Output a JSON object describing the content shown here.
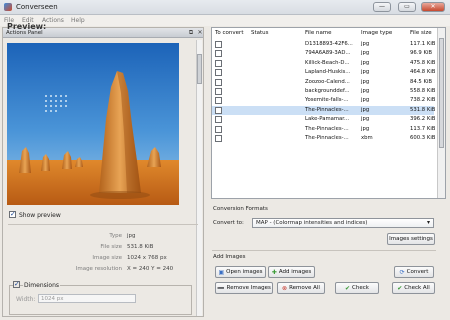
{
  "window": {
    "title": "Converseen",
    "min": "—",
    "max": "▭",
    "close": "✕"
  },
  "menu": [
    "File",
    "Edit",
    "Actions",
    "Help"
  ],
  "actions_panel": {
    "header": "Actions Panel",
    "preview_label": "Preview:",
    "show_preview_label": "Show preview",
    "show_preview_checked": true,
    "info": [
      {
        "key": "Type",
        "value": "jpg"
      },
      {
        "key": "File size",
        "value": "531.8 KiB"
      },
      {
        "key": "Image size",
        "value": "1024 x 768 px"
      },
      {
        "key": "Image resolution",
        "value": "X = 240 Y = 240"
      }
    ],
    "dimensions_label": "Dimensions",
    "dimensions_checked": true,
    "width_label": "Width:",
    "width_value": "1024 px"
  },
  "file_table": {
    "columns": [
      "To convert",
      "Status",
      "File name",
      "Image type",
      "File size"
    ],
    "rows": [
      {
        "file": "D1318893-42F6...",
        "type": "jpg",
        "size": "117.1 KiB",
        "checked": false,
        "selected": false
      },
      {
        "file": "794A6A89-3AD...",
        "type": "jpg",
        "size": "96.9 KiB",
        "checked": false,
        "selected": false
      },
      {
        "file": "Killick-Beach-D...",
        "type": "jpg",
        "size": "475.8 KiB",
        "checked": false,
        "selected": false
      },
      {
        "file": "Lapland-Huskis...",
        "type": "jpg",
        "size": "464.8 KiB",
        "checked": false,
        "selected": false
      },
      {
        "file": "Zoozoo-Calend...",
        "type": "jpg",
        "size": "84.5 KiB",
        "checked": false,
        "selected": false
      },
      {
        "file": "backgrounddef...",
        "type": "jpg",
        "size": "558.8 KiB",
        "checked": false,
        "selected": false
      },
      {
        "file": "Yosemite-falls-...",
        "type": "jpg",
        "size": "738.2 KiB",
        "checked": false,
        "selected": false
      },
      {
        "file": "The-Pinnacles-...",
        "type": "jpg",
        "size": "531.8 KiB",
        "checked": false,
        "selected": true
      },
      {
        "file": "Lake-Pamamar...",
        "type": "jpg",
        "size": "396.2 KiB",
        "checked": false,
        "selected": false
      },
      {
        "file": "The-Pinnacles-...",
        "type": "jpg",
        "size": "113.7 KiB",
        "checked": false,
        "selected": false
      },
      {
        "file": "The-Pinnacles-...",
        "type": "xbm",
        "size": "600.3 KiB",
        "checked": false,
        "selected": false
      }
    ]
  },
  "conversion": {
    "section_title": "Conversion Formats",
    "convert_to_label": "Convert to:",
    "format_value": "MAP - (Colormap intensities and indices)",
    "image_settings_button": "Images settings"
  },
  "add_images": {
    "section_title": "Add Images",
    "open_images": "Open images",
    "add_images": "Add images",
    "convert": "Convert",
    "remove_images": "Remove Images",
    "remove_all": "Remove All",
    "check": "Check",
    "check_all": "Check All"
  },
  "colors": {
    "accent": "#3b6fc4",
    "selected_row": "#cbdff5",
    "remove_red": "#c8362a",
    "add_green": "#3a9a35"
  }
}
